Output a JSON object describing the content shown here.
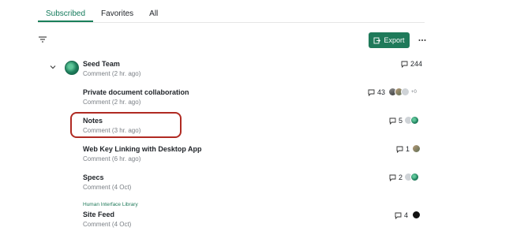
{
  "tabs": [
    {
      "label": "Subscribed",
      "active": true
    },
    {
      "label": "Favorites",
      "active": false
    },
    {
      "label": "All",
      "active": false
    }
  ],
  "toolbar": {
    "export_label": "Export",
    "filter_icon": "filter-icon",
    "more_icon": "more-horizontal-icon"
  },
  "team": {
    "title": "Seed Team",
    "meta": "Comment  (2 hr. ago)",
    "comment_count": "244"
  },
  "documents": [
    {
      "title": "Private document collaboration",
      "meta": "Comment  (2 hr. ago)",
      "comment_count": "43",
      "extra": "+0",
      "tag": ""
    },
    {
      "title": "Notes",
      "meta": "Comment  (3 hr. ago)",
      "comment_count": "5",
      "extra": "",
      "tag": ""
    },
    {
      "title": "Web Key Linking with Desktop App",
      "meta": "Comment  (6 hr. ago)",
      "comment_count": "1",
      "extra": "",
      "tag": ""
    },
    {
      "title": "Specs",
      "meta": "Comment  (4 Oct)",
      "comment_count": "2",
      "extra": "",
      "tag": ""
    },
    {
      "title": "Site Feed",
      "meta": "Comment  (4 Oct)",
      "comment_count": "4",
      "extra": "",
      "tag": "Human Interface Library"
    }
  ],
  "colors": {
    "accent": "#1f7a5a",
    "highlight": "#b02a22"
  }
}
